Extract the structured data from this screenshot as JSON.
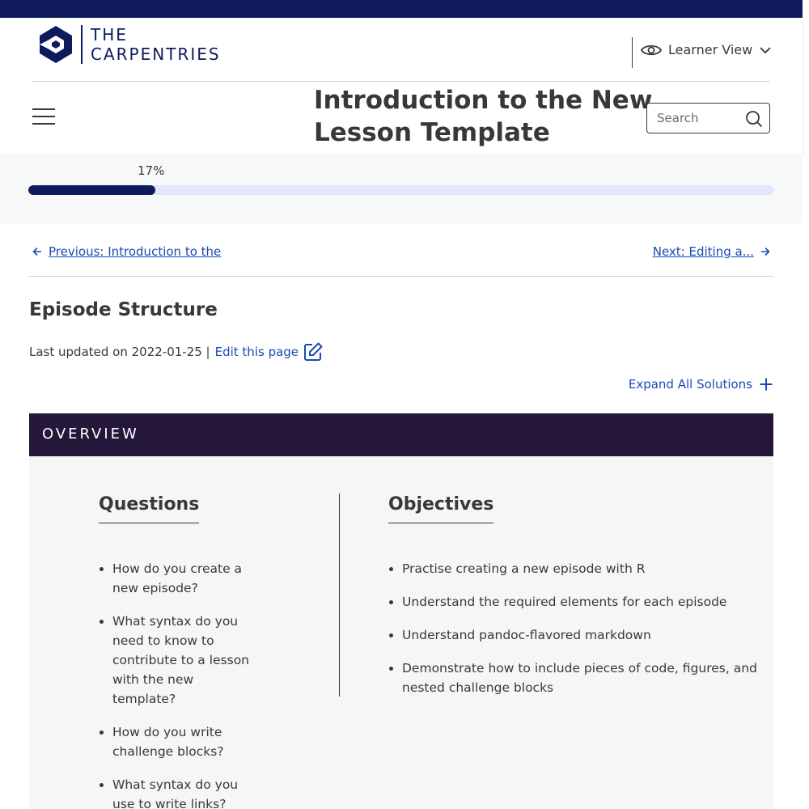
{
  "brand": {
    "line1": "THE",
    "line2": "CARPENTRIES",
    "color": "#0e1a5c"
  },
  "view_selector": {
    "label": "Learner View",
    "icon": "eye-icon"
  },
  "site_title": "Introduction to the New Lesson Template",
  "search": {
    "placeholder": "Search",
    "icon": "search-icon"
  },
  "progress": {
    "label": "17%",
    "value": 0.17
  },
  "nav": {
    "previous": "Previous: Introduction to the",
    "next": "Next: Editing a..."
  },
  "episode": {
    "title": "Episode Structure",
    "updated": "Last updated on 2022-01-25 |",
    "edit_link": "Edit this page"
  },
  "expand_all": "Expand All Solutions",
  "overview": {
    "heading": "OVERVIEW",
    "questions_heading": "Questions",
    "objectives_heading": "Objectives",
    "questions": [
      "How do you create a new episode?",
      "What syntax do you need to know to contribute to a lesson with the new template?",
      "How do you write challenge blocks?",
      "What syntax do you use to write links?"
    ],
    "objectives": [
      "Practise creating a new episode with R",
      "Understand the required elements for each episode",
      "Understand pandoc-flavored markdown",
      "Demonstrate how to include pieces of code, figures, and nested challenge blocks"
    ]
  },
  "colors": {
    "link": "#1a49b5",
    "overview_header": "#24173a",
    "progress_fill": "#0e1a5c",
    "progress_track": "#e3e5fb"
  }
}
